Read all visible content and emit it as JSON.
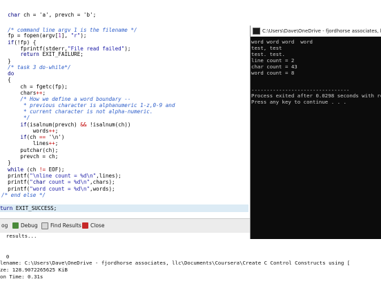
{
  "editor": {
    "lines": [
      "  char ch = 'a', prevch = 'b';",
      "",
      "  /* command line argv 1 is the filename */",
      "  fp = fopen(argv[1], \"r\");",
      "  if(!fp) {",
      "      fprintf(stderr,\"File read failed\");",
      "      return EXIT_FAILURE;",
      "  }",
      "  /* task 3 do-while*/",
      "  do",
      "  {",
      "      ch = fgetc(fp);",
      "      chars++;",
      "      /* How we define a word boundary --",
      "       * previous character is alphanumeric 1-z,0-9 and",
      "       * current character is not alpha-numeric.",
      "       */",
      "      if(isalnum(prevch) && !isalnum(ch))",
      "          words++;",
      "      if(ch == '\\n')",
      "          lines++;",
      "      putchar(ch);",
      "      prevch = ch;",
      "  }",
      "  while (ch != EOF);",
      "  printf(\"\\nline count = %d\\n\",lines);",
      "  printf(\"char count = %d\\n\",chars);",
      "  printf(\"word count = %d\\n\",words);",
      "/* end else */",
      "",
      "turn EXIT_SUCCESS;"
    ]
  },
  "bottom_tabs": [
    {
      "label": "og"
    },
    {
      "label": "Debug"
    },
    {
      "label": "Find Results"
    },
    {
      "label": "Close"
    }
  ],
  "log": {
    "lines": [
      "  results...",
      "",
      "",
      "  0",
      "lename: C:\\Users\\Dave\\OneDrive - fjordhorse associates, llc\\Documents\\Coursera\\Create C Control Constructs using [",
      "ze: 128.9072265625 KiB",
      "on Time: 0.31s"
    ]
  },
  "console": {
    "title": "C:\\Users\\Dave\\OneDrive - fjordhorse associates, llc\\Docu",
    "lines": [
      "word word word  word",
      "test, test",
      "test. test.",
      "line count = 2",
      "char count = 43",
      "word count = 8",
      "",
      "--------------------------------",
      "Process exited after 0.0298 seconds with re",
      "Press any key to continue . . ."
    ]
  }
}
